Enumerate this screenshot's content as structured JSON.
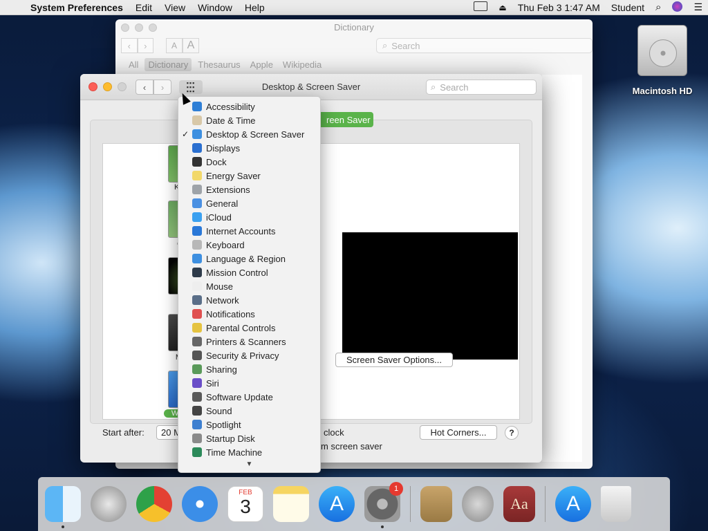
{
  "menubar": {
    "app_name": "System Preferences",
    "items": [
      "Edit",
      "View",
      "Window",
      "Help"
    ],
    "clock": "Thu Feb 3  1:47 AM",
    "user": "Student"
  },
  "desktop": {
    "hd_label": "Macintosh HD"
  },
  "dictionary": {
    "title": "Dictionary",
    "search_placeholder": "Search",
    "font_small": "A",
    "font_large": "A",
    "tabs": [
      "All",
      "Dictionary",
      "Thesaurus",
      "Apple",
      "Wikipedia"
    ]
  },
  "prefs": {
    "title": "Desktop & Screen Saver",
    "search_placeholder": "Search",
    "tab_label": "reen Saver",
    "thumb_labels": [
      "Ken B",
      "Clas",
      "Flur",
      "Mess",
      "Word of"
    ],
    "screen_saver_options": "Screen Saver Options...",
    "start_after_label": "Start after:",
    "start_after_value": "20 M",
    "clock_text": "clock",
    "hot_corners": "Hot Corners...",
    "help": "?",
    "bottom_text": "m screen saver"
  },
  "popup": {
    "checked_index": 2,
    "items": [
      {
        "label": "Accessibility",
        "icon": "accessibility-icon",
        "color": "#2f7fd6"
      },
      {
        "label": "Date & Time",
        "icon": "clock-icon",
        "color": "#d8c8a8"
      },
      {
        "label": "Desktop & Screen Saver",
        "icon": "desktop-icon",
        "color": "#3d8fe0"
      },
      {
        "label": "Displays",
        "icon": "display-icon",
        "color": "#2a6fd0"
      },
      {
        "label": "Dock",
        "icon": "dock-icon",
        "color": "#333333"
      },
      {
        "label": "Energy Saver",
        "icon": "lightbulb-icon",
        "color": "#f2d86a"
      },
      {
        "label": "Extensions",
        "icon": "puzzle-icon",
        "color": "#9ea3a8"
      },
      {
        "label": "General",
        "icon": "general-icon",
        "color": "#4a90e2"
      },
      {
        "label": "iCloud",
        "icon": "cloud-icon",
        "color": "#3aa0f0"
      },
      {
        "label": "Internet Accounts",
        "icon": "at-icon",
        "color": "#2a78d8"
      },
      {
        "label": "Keyboard",
        "icon": "keyboard-icon",
        "color": "#b8b8b8"
      },
      {
        "label": "Language & Region",
        "icon": "flag-icon",
        "color": "#3d8fe0"
      },
      {
        "label": "Mission Control",
        "icon": "mission-control-icon",
        "color": "#2e3b4a"
      },
      {
        "label": "Mouse",
        "icon": "mouse-icon",
        "color": "#eeeeee"
      },
      {
        "label": "Network",
        "icon": "globe-icon",
        "color": "#5a6e88"
      },
      {
        "label": "Notifications",
        "icon": "bell-icon",
        "color": "#e05050"
      },
      {
        "label": "Parental Controls",
        "icon": "parental-icon",
        "color": "#e5c340"
      },
      {
        "label": "Printers & Scanners",
        "icon": "printer-icon",
        "color": "#666666"
      },
      {
        "label": "Security & Privacy",
        "icon": "lock-icon",
        "color": "#555555"
      },
      {
        "label": "Sharing",
        "icon": "sharing-icon",
        "color": "#5a9a5a"
      },
      {
        "label": "Siri",
        "icon": "siri-icon",
        "color": "#6a4ec8"
      },
      {
        "label": "Software Update",
        "icon": "gear-icon",
        "color": "#5a5a5a"
      },
      {
        "label": "Sound",
        "icon": "speaker-icon",
        "color": "#444444"
      },
      {
        "label": "Spotlight",
        "icon": "search-icon",
        "color": "#3d7fd0"
      },
      {
        "label": "Startup Disk",
        "icon": "disk-icon",
        "color": "#8a8a8a"
      },
      {
        "label": "Time Machine",
        "icon": "time-machine-icon",
        "color": "#2c8a5a"
      }
    ],
    "more_arrow": "▼"
  },
  "dock": {
    "calendar_month": "FEB",
    "calendar_day": "3",
    "badge": "1",
    "book_glyph": "Aa"
  }
}
